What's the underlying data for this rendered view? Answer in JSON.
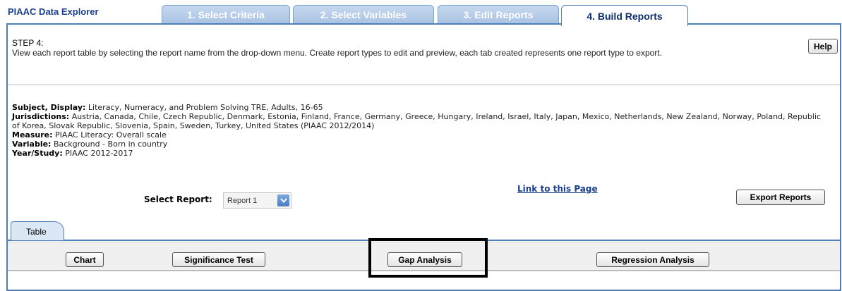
{
  "app_title": "PIAAC Data Explorer",
  "tabs": [
    {
      "label": "1. Select Criteria",
      "active": false
    },
    {
      "label": "2. Select Variables",
      "active": false
    },
    {
      "label": "3. Edit Reports",
      "active": false
    },
    {
      "label": "4. Build Reports",
      "active": true
    }
  ],
  "step": {
    "title": "STEP 4:",
    "description": "View each report table by selecting the report name from the drop-down menu. Create report types to edit and preview, each tab created represents one report type to export."
  },
  "help_label": "Help",
  "criteria": {
    "subject_label": "Subject, Display:",
    "subject_value": "Literacy, Numeracy, and Problem Solving TRE, Adults, 16-65",
    "jurisdictions_label": "Jurisdictions:",
    "jurisdictions_value": "Austria, Canada, Chile, Czech Republic, Denmark, Estonia, Finland, France, Germany, Greece, Hungary, Ireland, Israel, Italy, Japan, Mexico, Netherlands, New Zealand, Norway, Poland, Republic of Korea, Slovak Republic, Slovenia, Spain, Sweden, Turkey, United States (PIAAC 2012/2014)",
    "measure_label": "Measure:",
    "measure_value": "PIAAC Literacy: Overall scale",
    "variable_label": "Variable:",
    "variable_value": "Background - Born in country",
    "year_label": "Year/Study:",
    "year_value": "PIAAC 2012-2017"
  },
  "select_report": {
    "label": "Select Report:",
    "value": "Report 1"
  },
  "link_label": "Link to this Page",
  "export_label": "Export Reports",
  "subtab_label": "Table",
  "toolbar": {
    "chart": "Chart",
    "significance": "Significance Test",
    "gap": "Gap Analysis",
    "regression": "Regression Analysis"
  },
  "colors": {
    "accent": "#4f7fb8",
    "title": "#1a3f8f",
    "tab_inactive": "#a9c3e3",
    "dropdown": "#4a7cc6"
  },
  "icons": {
    "dropdown": "chevron-down-icon"
  }
}
